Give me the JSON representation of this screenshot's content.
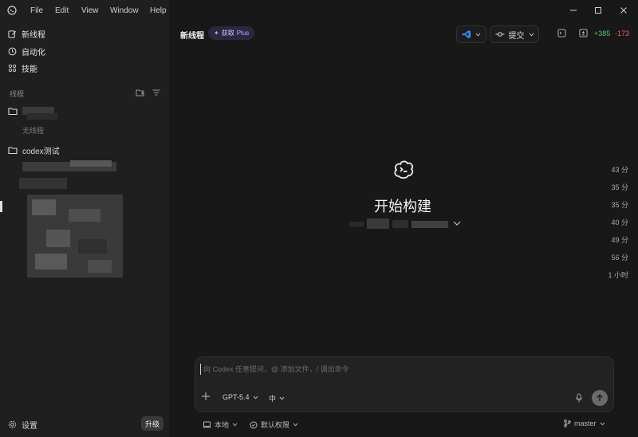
{
  "menu": {
    "items": [
      "File",
      "Edit",
      "View",
      "Window",
      "Help"
    ]
  },
  "sidebar": {
    "nav": [
      {
        "label": "新线程",
        "icon": "edit-icon"
      },
      {
        "label": "自动化",
        "icon": "clock-icon"
      },
      {
        "label": "技能",
        "icon": "grid-icon"
      }
    ],
    "threads_header": "线程",
    "folder_project": {
      "icon": "folder-icon"
    },
    "no_threads": "无线程",
    "folder_codex": {
      "label": "codex测试",
      "icon": "folder-icon"
    },
    "thread_times": [
      "43 分",
      "35 分",
      "35 分",
      "40 分",
      "49 分",
      "56 分",
      "1 小时"
    ],
    "settings_label": "设置",
    "upgrade_label": "升级"
  },
  "header": {
    "title": "新线程",
    "get_plus": {
      "star": "✦",
      "prefix": "获取",
      "plan": "Plus"
    },
    "commit_label": "提交",
    "diff_added": "+385",
    "diff_removed": "-173"
  },
  "hero": {
    "title": "开始构建",
    "icon": "codex-cloud-icon"
  },
  "composer": {
    "placeholder": "向 Codex 任意提问，@ 添加文件，/ 调出命令",
    "model": "GPT-5.4",
    "reasoning": "中"
  },
  "footer": {
    "local_label": "本地",
    "permission_label": "默认权限",
    "branch": "master"
  },
  "colors": {
    "sidebar_bg": "#1f1f1f",
    "main_bg": "#181818",
    "plus_accent": "#b9a4ff",
    "vscode_blue": "#2f8fff",
    "diff_add": "#4ecb71",
    "diff_del": "#ef5f5f"
  }
}
